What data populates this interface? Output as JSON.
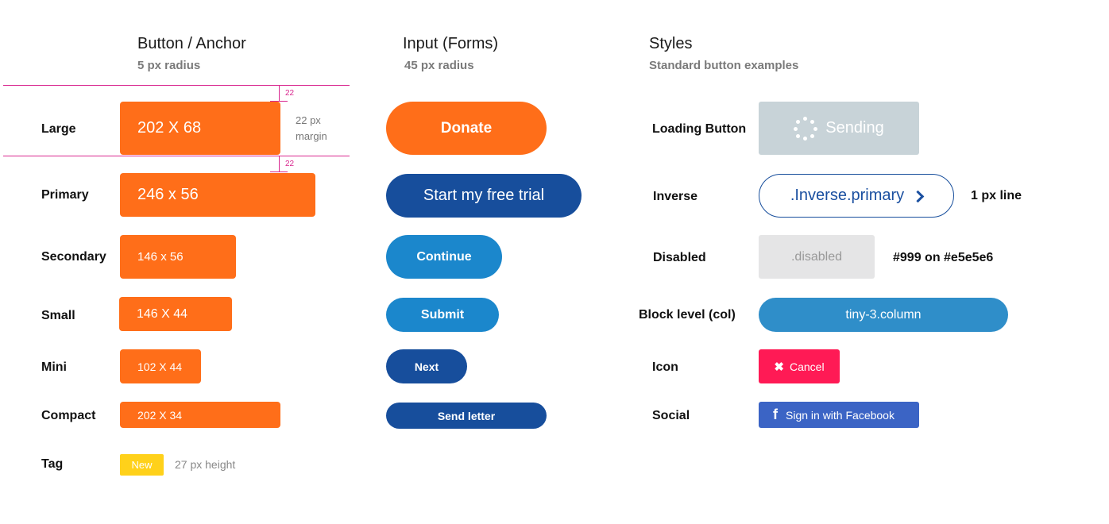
{
  "columns": {
    "button": {
      "title": "Button / Anchor",
      "subtitle": "5 px radius"
    },
    "input": {
      "title": "Input (Forms)",
      "subtitle": "45 px radius"
    },
    "styles": {
      "title": "Styles",
      "subtitle": "Standard button examples"
    }
  },
  "labels": {
    "large": "Large",
    "primary": "Primary",
    "secondary": "Secondary",
    "small": "Small",
    "mini": "Mini",
    "compact": "Compact",
    "tag": "Tag"
  },
  "anchor_buttons": {
    "large": "202 X 68",
    "primary": "246 x 56",
    "secondary": "146 x 56",
    "small": "146 X 44",
    "mini": "102 X 44",
    "compact": "202 X 34",
    "tag": "New"
  },
  "annotations": {
    "margin_top": "22",
    "margin_bottom": "22",
    "margin_line1": "22 px",
    "margin_line2": "margin",
    "tag_height": "27 px height",
    "inverse_note": "1 px line",
    "disabled_note": "#999 on #e5e5e6"
  },
  "input_buttons": {
    "donate": "Donate",
    "trial": "Start my free trial",
    "continue": "Continue",
    "submit": "Submit",
    "next": "Next",
    "send": "Send letter"
  },
  "style_labels": {
    "loading": "Loading Button",
    "inverse": "Inverse",
    "disabled": "Disabled",
    "block": "Block level (col)",
    "icon": "Icon",
    "social": "Social"
  },
  "style_buttons": {
    "loading": "Sending",
    "inverse": ".Inverse.primary",
    "disabled": ".disabled",
    "block": "tiny-3.column",
    "cancel": "Cancel",
    "facebook": "Sign in with Facebook"
  },
  "colors": {
    "orange": "#ff6e19",
    "dark_blue": "#174e9c",
    "mid_blue": "#1b87cc",
    "loading_gray": "#c8d3d8",
    "disabled_bg": "#e5e5e6",
    "disabled_text": "#999999",
    "block_blue": "#2f8ec9",
    "cancel_red": "#ff1a55",
    "facebook_blue": "#3b64c5",
    "tag_yellow": "#ffd11a",
    "guide_magenta": "#d9278f"
  },
  "icons": {
    "loading": "spinner-icon",
    "inverse": "chevron-right-icon",
    "cancel": "close-icon",
    "facebook": "facebook-icon"
  }
}
